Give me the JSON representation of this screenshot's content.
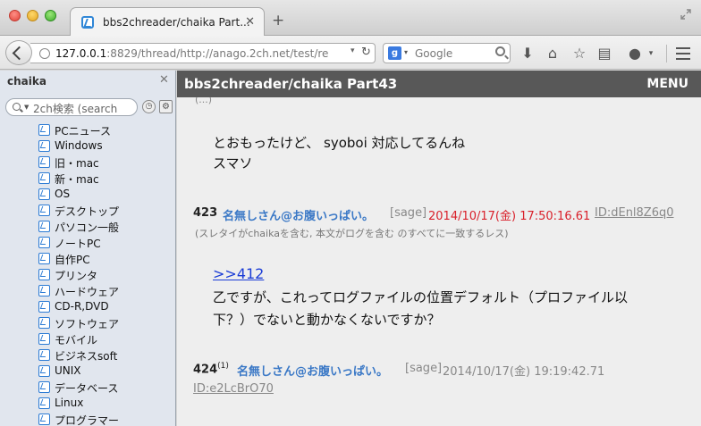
{
  "tab": {
    "title": "bbs2chreader/chaika Part..."
  },
  "url": {
    "host": "127.0.0.1",
    "rest": ":8829/thread/http://anago.2ch.net/test/re"
  },
  "search": {
    "placeholder": "Google",
    "engine_badge": "g"
  },
  "sidebar": {
    "title": "chaika",
    "search_placeholder": "2ch検索 (search",
    "boards": [
      "PCニュース",
      "Windows",
      "旧・mac",
      "新・mac",
      "OS",
      "デスクトップ",
      "パソコン一般",
      "ノートPC",
      "自作PC",
      "プリンタ",
      "ハードウェア",
      "CD-R,DVD",
      "ソフトウェア",
      "モバイル",
      "ビジネスsoft",
      "UNIX",
      "データベース",
      "Linux",
      "プログラマー"
    ]
  },
  "thread": {
    "title": "bbs2chreader/chaika Part43",
    "menu": "MENU",
    "prev_body": [
      "とおもったけど、 syoboi 対応してるんね",
      "スマソ"
    ],
    "posts": [
      {
        "num": "423",
        "name": "名無しさん@お腹いっぱい。",
        "mail": "[sage]",
        "date": "2014/10/17(金) 17:50:16.61",
        "id": "ID:dEnl8Z6q0",
        "note": "(スレタイがchaikaを含む, 本文がログを含む のすべてに一致するレス)",
        "anchor": ">>412",
        "body": [
          "乙ですが、これってログファイルの位置デフォルト（プロファイル以",
          "下？）でないと動かなくないですか？"
        ]
      },
      {
        "num": "424",
        "refs": "(1)",
        "name": "名無しさん@お腹いっぱい。",
        "mail": "[sage]",
        "date": "2014/10/17(金) 19:19:42.71",
        "id": "ID:e2LcBrO70"
      }
    ]
  },
  "colors": {
    "accent_link": "#3a78c6",
    "highlight_date": "#d9202a",
    "header_bg": "#585858"
  }
}
